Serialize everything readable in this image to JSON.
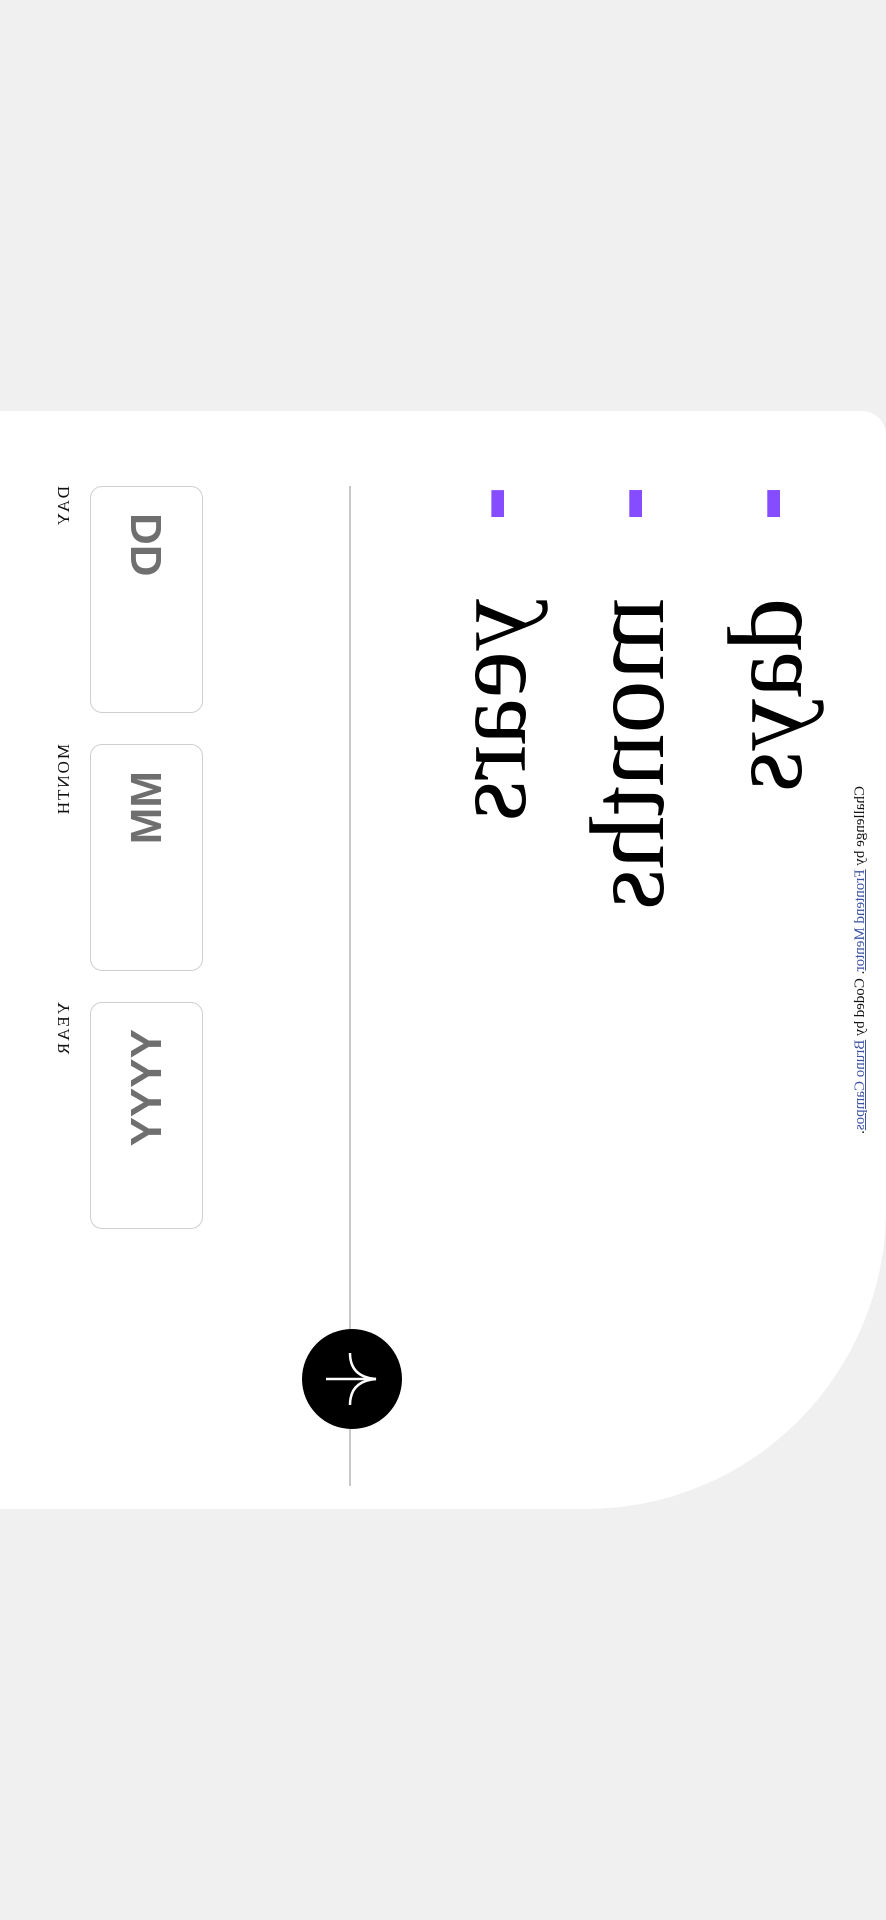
{
  "form": {
    "day": {
      "label": "Day",
      "placeholder": "DD"
    },
    "month": {
      "label": "Month",
      "placeholder": "MM"
    },
    "year": {
      "label": "Year",
      "placeholder": "YYYY"
    }
  },
  "results": [
    {
      "value": "- -",
      "unit": "years"
    },
    {
      "value": "- -",
      "unit": "months"
    },
    {
      "value": "- -",
      "unit": "days"
    }
  ],
  "attribution": {
    "prefix": "Challenge by ",
    "challenge_link": "Frontend Mentor",
    "middle": ". Coded by ",
    "author_link": "Bruno Campos",
    "suffix": "."
  },
  "icons": {
    "submit": "arrow-down-icon"
  },
  "colors": {
    "accent": "#854dff",
    "button": "#000000",
    "background": "#f0f0f0"
  }
}
